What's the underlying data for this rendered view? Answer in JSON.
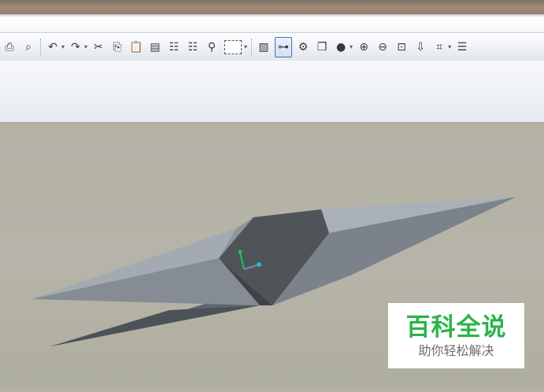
{
  "window": {
    "titlebar_colors": {
      "bar": "#8d7b70",
      "edge": "#ffffff"
    }
  },
  "toolbar": {
    "buttons": [
      {
        "icon": "print-icon",
        "glyph": "⎙"
      },
      {
        "icon": "print-preview-icon",
        "glyph": "⌕"
      },
      {
        "icon": "undo-icon",
        "glyph": "↶",
        "has_dropdown": true
      },
      {
        "icon": "redo-icon",
        "glyph": "↷",
        "has_dropdown": true
      },
      {
        "icon": "cut-icon",
        "glyph": "✂"
      },
      {
        "icon": "copy-icon",
        "glyph": "⎘"
      },
      {
        "icon": "paste-icon",
        "glyph": "📋"
      },
      {
        "icon": "paste-special-icon",
        "glyph": "▤"
      },
      {
        "icon": "regenerate-icon",
        "glyph": "☷"
      },
      {
        "icon": "regenerate-manager-icon",
        "glyph": "☷"
      },
      {
        "icon": "find-icon",
        "glyph": "⚲"
      },
      {
        "icon": "select-box-icon",
        "glyph": "",
        "has_dropdown": true
      },
      {
        "icon": "repaint-icon",
        "glyph": "▧"
      },
      {
        "icon": "spin-center-icon",
        "glyph": "⊶",
        "active": true
      },
      {
        "icon": "orient-mode-icon",
        "glyph": "⚙"
      },
      {
        "icon": "saved-views-icon",
        "glyph": "❒"
      },
      {
        "icon": "display-style-icon",
        "glyph": "●",
        "has_dropdown": true
      },
      {
        "icon": "zoom-in-icon",
        "glyph": "⊕"
      },
      {
        "icon": "zoom-out-icon",
        "glyph": "⊖"
      },
      {
        "icon": "refit-icon",
        "glyph": "⊡"
      },
      {
        "icon": "view-manager-icon",
        "glyph": "⇩"
      },
      {
        "icon": "annotation-display-icon",
        "glyph": "⌗",
        "has_dropdown": true
      },
      {
        "icon": "layers-icon",
        "glyph": "☰"
      }
    ]
  },
  "model": {
    "colors": {
      "viewport_bg": "#b4b2a5",
      "face_light": "#9aa3ad",
      "face_mid": "#6e757d",
      "face_dark": "#4a4e53",
      "axis_x": "#e0344f",
      "axis_y": "#22c25a",
      "axis_z": "#21b8d6"
    }
  },
  "watermark": {
    "title": "百科全说",
    "subtitle": "助你轻松解决",
    "title_color": "#2bb34a"
  }
}
